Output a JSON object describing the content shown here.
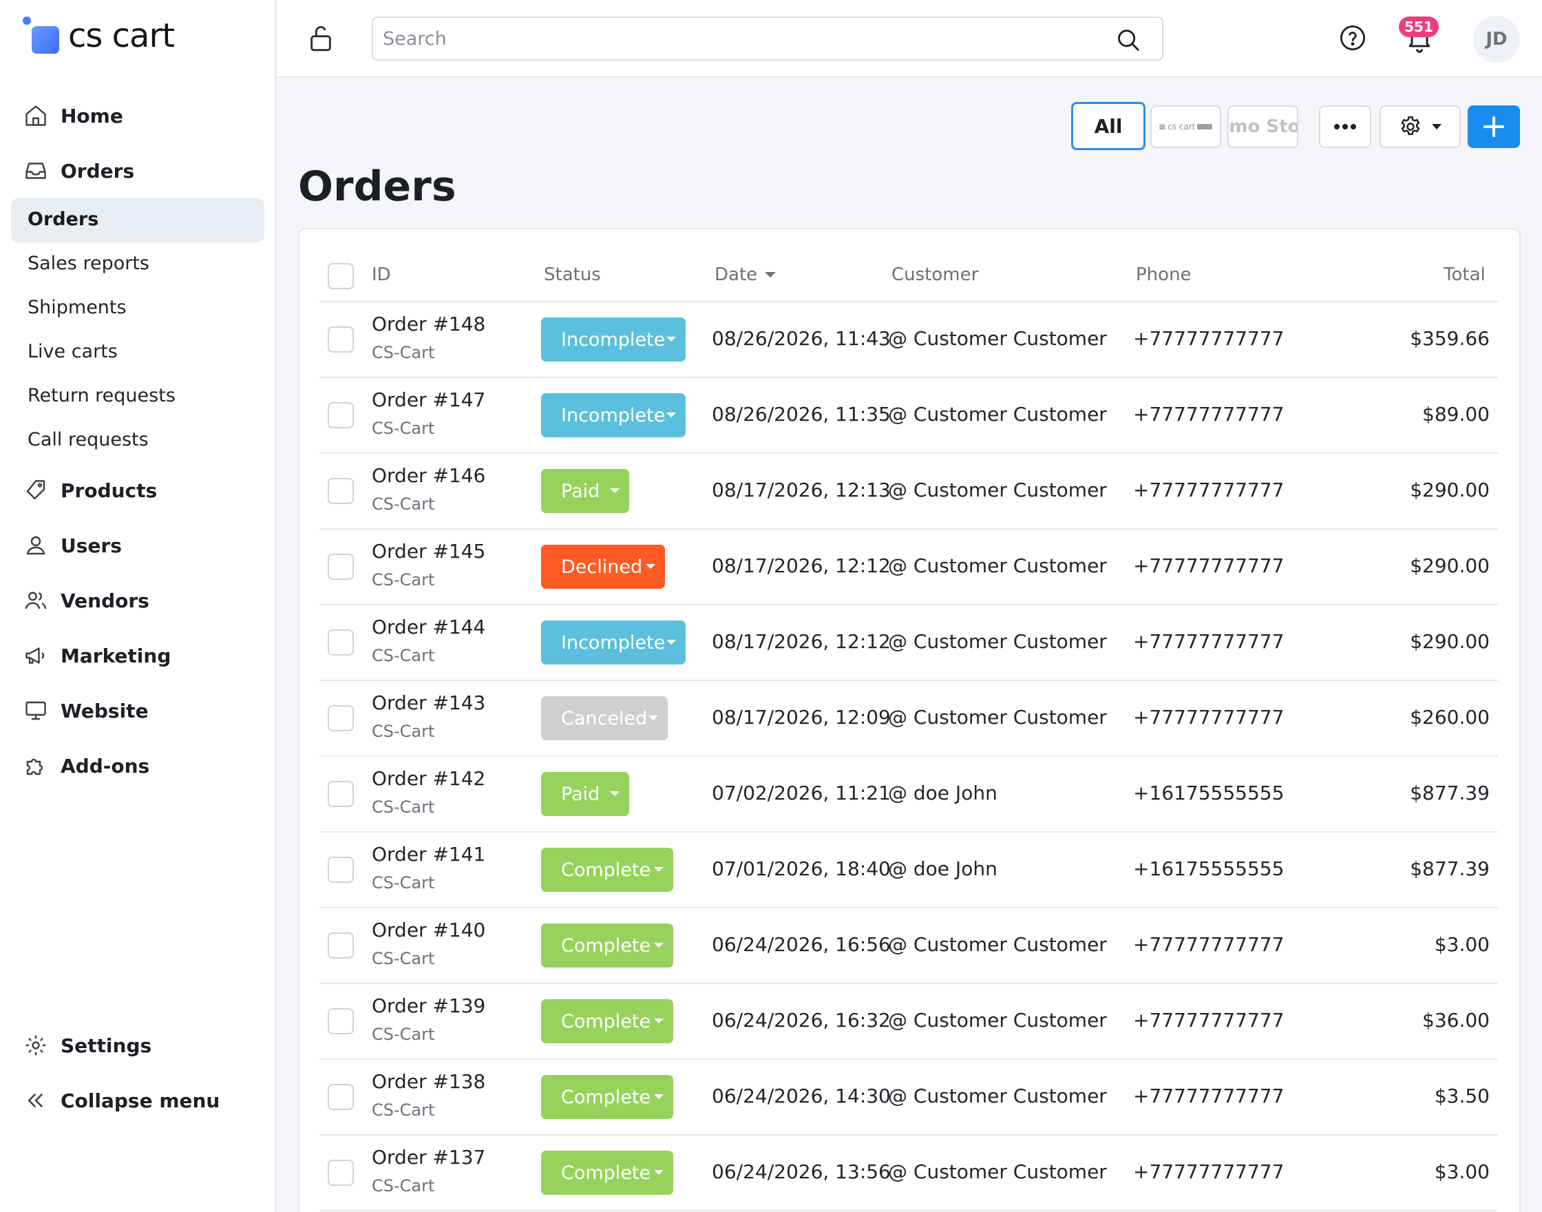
{
  "brand": {
    "name": "cs cart"
  },
  "sidebar": {
    "home": "Home",
    "orders": "Orders",
    "orders_sub": [
      "Orders",
      "Sales reports",
      "Shipments",
      "Live carts",
      "Return requests",
      "Call requests"
    ],
    "products": "Products",
    "users": "Users",
    "vendors": "Vendors",
    "marketing": "Marketing",
    "website": "Website",
    "addons": "Add-ons",
    "settings": "Settings",
    "collapse": "Collapse menu"
  },
  "topbar": {
    "search_placeholder": "Search",
    "notifications_count": "551",
    "avatar_initials": "JD"
  },
  "toolbar": {
    "all_label": "All",
    "store1_label": "cs cart",
    "store2_label": "emo Stor",
    "accent_color": "#1a8cf0"
  },
  "page": {
    "title": "Orders"
  },
  "table": {
    "headers": {
      "id": "ID",
      "status": "Status",
      "date": "Date",
      "customer": "Customer",
      "phone": "Phone",
      "total": "Total"
    },
    "rows": [
      {
        "id": "Order #148",
        "store": "CS-Cart",
        "status": "Incomplete",
        "color": "#5bc0de",
        "date": "08/26/2026, 11:43",
        "customer": "@ Customer Customer",
        "phone": "+77777777777",
        "total": "$359.66"
      },
      {
        "id": "Order #147",
        "store": "CS-Cart",
        "status": "Incomplete",
        "color": "#5bc0de",
        "date": "08/26/2026, 11:35",
        "customer": "@ Customer Customer",
        "phone": "+77777777777",
        "total": "$89.00"
      },
      {
        "id": "Order #146",
        "store": "CS-Cart",
        "status": "Paid",
        "color": "#97d35c",
        "date": "08/17/2026, 12:13",
        "customer": "@ Customer Customer",
        "phone": "+77777777777",
        "total": "$290.00"
      },
      {
        "id": "Order #145",
        "store": "CS-Cart",
        "status": "Declined",
        "color": "#ff5a23",
        "date": "08/17/2026, 12:12",
        "customer": "@ Customer Customer",
        "phone": "+77777777777",
        "total": "$290.00"
      },
      {
        "id": "Order #144",
        "store": "CS-Cart",
        "status": "Incomplete",
        "color": "#5bc0de",
        "date": "08/17/2026, 12:12",
        "customer": "@ Customer Customer",
        "phone": "+77777777777",
        "total": "$290.00"
      },
      {
        "id": "Order #143",
        "store": "CS-Cart",
        "status": "Canceled",
        "color": "#cfcfcf",
        "date": "08/17/2026, 12:09",
        "customer": "@ Customer Customer",
        "phone": "+77777777777",
        "total": "$260.00"
      },
      {
        "id": "Order #142",
        "store": "CS-Cart",
        "status": "Paid",
        "color": "#97d35c",
        "date": "07/02/2026, 11:21",
        "customer": "@ doe John",
        "phone": "+16175555555",
        "total": "$877.39"
      },
      {
        "id": "Order #141",
        "store": "CS-Cart",
        "status": "Complete",
        "color": "#97d35c",
        "date": "07/01/2026, 18:40",
        "customer": "@ doe John",
        "phone": "+16175555555",
        "total": "$877.39"
      },
      {
        "id": "Order #140",
        "store": "CS-Cart",
        "status": "Complete",
        "color": "#97d35c",
        "date": "06/24/2026, 16:56",
        "customer": "@ Customer Customer",
        "phone": "+77777777777",
        "total": "$3.00"
      },
      {
        "id": "Order #139",
        "store": "CS-Cart",
        "status": "Complete",
        "color": "#97d35c",
        "date": "06/24/2026, 16:32",
        "customer": "@ Customer Customer",
        "phone": "+77777777777",
        "total": "$36.00"
      },
      {
        "id": "Order #138",
        "store": "CS-Cart",
        "status": "Complete",
        "color": "#97d35c",
        "date": "06/24/2026, 14:30",
        "customer": "@ Customer Customer",
        "phone": "+77777777777",
        "total": "$3.50"
      },
      {
        "id": "Order #137",
        "store": "CS-Cart",
        "status": "Complete",
        "color": "#97d35c",
        "date": "06/24/2026, 13:56",
        "customer": "@ Customer Customer",
        "phone": "+77777777777",
        "total": "$3.00"
      }
    ]
  }
}
